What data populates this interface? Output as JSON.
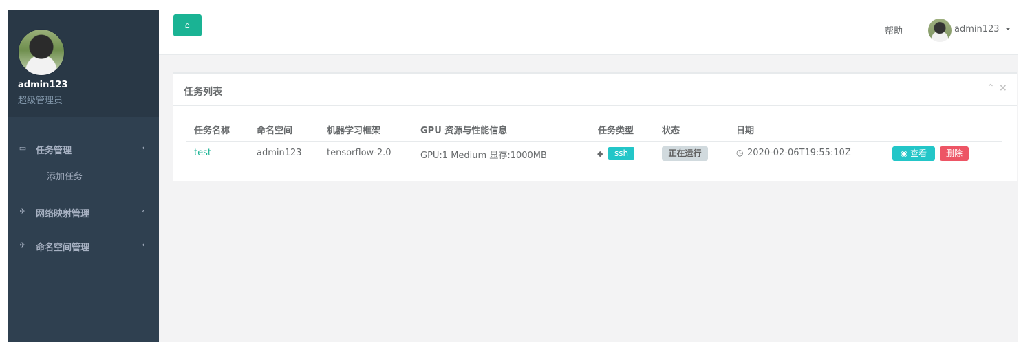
{
  "sidebar": {
    "profile": {
      "name": "admin123",
      "role": "超级管理员"
    },
    "menu": [
      {
        "label": "任务管理",
        "icon": "inbox-icon",
        "children": [
          {
            "label": "添加任务"
          }
        ]
      },
      {
        "label": "网络映射管理",
        "icon": "plane-icon"
      },
      {
        "label": "命名空间管理",
        "icon": "plane-icon"
      }
    ]
  },
  "topbar": {
    "home_icon": "home-icon",
    "help_label": "帮助",
    "username": "admin123"
  },
  "panel": {
    "title": "任务列表",
    "table": {
      "headers": [
        "任务名称",
        "命名空间",
        "机器学习框架",
        "GPU 资源与性能信息",
        "任务类型",
        "状态",
        "日期"
      ],
      "rows": [
        {
          "name": "test",
          "namespace": "admin123",
          "framework": "tensorflow-2.0",
          "gpu_info": "GPU:1 Medium 显存:1000MB",
          "task_type": "ssh",
          "status": "正在运行",
          "date": "2020-02-06T19:55:10Z",
          "view_label": "查看",
          "delete_label": "删除"
        }
      ]
    }
  },
  "colors": {
    "sidebar_bg": "#2f4050",
    "accent_green": "#1ab394",
    "info_cyan": "#23c6c8",
    "danger_red": "#ed5565",
    "status_gray": "#d1dade"
  }
}
